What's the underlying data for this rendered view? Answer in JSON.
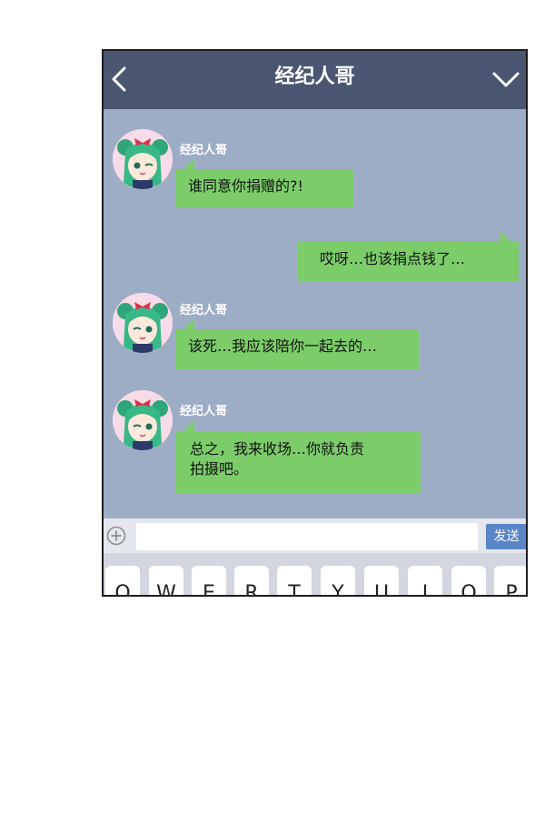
{
  "header": {
    "title": "经纪人哥"
  },
  "messages": [
    {
      "side": "left",
      "sender": "经纪人哥",
      "text": "谁同意你捐赠的?!"
    },
    {
      "side": "right",
      "text": "哎呀…也该捐点钱了…"
    },
    {
      "side": "left",
      "sender": "经纪人哥",
      "text": "该死…我应该陪你一起去的…"
    },
    {
      "side": "left",
      "sender": "经纪人哥",
      "line1": "总之，我来收场…你就负责",
      "line2": "拍摄吧。"
    }
  ],
  "input": {
    "value": "",
    "send_label": "发送"
  },
  "keyboard": {
    "keys": [
      "Q",
      "W",
      "E",
      "R",
      "T",
      "Y",
      "U",
      "I",
      "O",
      "P"
    ]
  },
  "colors": {
    "header": "#4a5672",
    "chat_bg": "#9eadc6",
    "bubble": "#7ccd6a",
    "send": "#5a86c8"
  }
}
